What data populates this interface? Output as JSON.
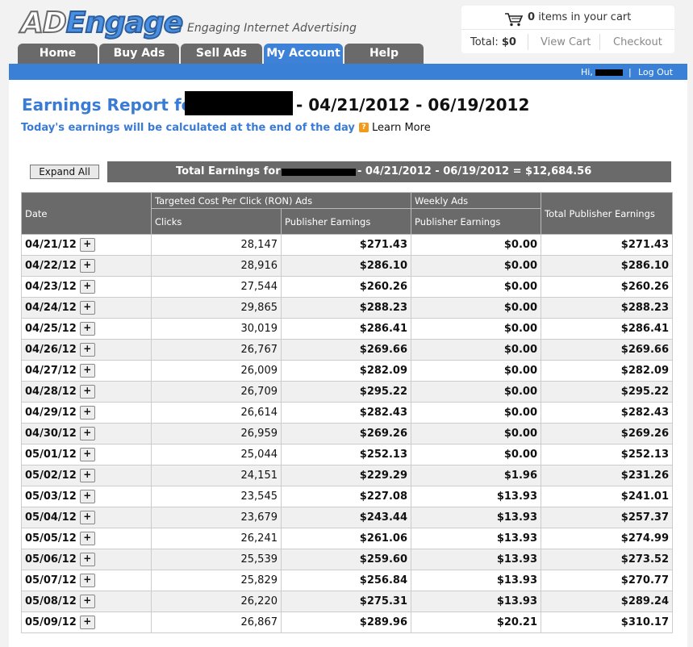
{
  "logo": {
    "ad": "AD",
    "engage": "Engage",
    "tagline": "Engaging Internet Advertising"
  },
  "cart": {
    "count": "0",
    "items_text": "items in your cart",
    "total_label": "Total:",
    "total_value": "$0",
    "view_cart": "View Cart",
    "checkout": "Checkout"
  },
  "nav": {
    "tabs": [
      {
        "label": "Home"
      },
      {
        "label": "Buy Ads"
      },
      {
        "label": "Sell Ads"
      },
      {
        "label": "My Account"
      },
      {
        "label": "Help"
      }
    ]
  },
  "userbar": {
    "hi": "Hi,",
    "separator": "|",
    "logout": "Log Out"
  },
  "report": {
    "title": "Earnings Report for",
    "range": "- 04/21/2012 - 06/19/2012",
    "subtitle": "Today's earnings will be calculated at the end of the day",
    "learn_more": "Learn More",
    "expand_all": "Expand All",
    "total_label": "Total Earnings for",
    "total_range": "- 04/21/2012 - 06/19/2012 = $12,684.56"
  },
  "table": {
    "headers": {
      "date": "Date",
      "cpc_group": "Targeted Cost Per Click (RON) Ads",
      "clicks": "Clicks",
      "publisher_earnings": "Publisher Earnings",
      "weekly_group": "Weekly Ads",
      "weekly_publisher": "Publisher Earnings",
      "total": "Total Publisher Earnings"
    },
    "rows": [
      {
        "date": "04/21/12",
        "clicks": "28,147",
        "cpc": "$271.43",
        "weekly": "$0.00",
        "total": "$271.43"
      },
      {
        "date": "04/22/12",
        "clicks": "28,916",
        "cpc": "$286.10",
        "weekly": "$0.00",
        "total": "$286.10"
      },
      {
        "date": "04/23/12",
        "clicks": "27,544",
        "cpc": "$260.26",
        "weekly": "$0.00",
        "total": "$260.26"
      },
      {
        "date": "04/24/12",
        "clicks": "29,865",
        "cpc": "$288.23",
        "weekly": "$0.00",
        "total": "$288.23"
      },
      {
        "date": "04/25/12",
        "clicks": "30,019",
        "cpc": "$286.41",
        "weekly": "$0.00",
        "total": "$286.41"
      },
      {
        "date": "04/26/12",
        "clicks": "26,767",
        "cpc": "$269.66",
        "weekly": "$0.00",
        "total": "$269.66"
      },
      {
        "date": "04/27/12",
        "clicks": "26,009",
        "cpc": "$282.09",
        "weekly": "$0.00",
        "total": "$282.09"
      },
      {
        "date": "04/28/12",
        "clicks": "26,709",
        "cpc": "$295.22",
        "weekly": "$0.00",
        "total": "$295.22"
      },
      {
        "date": "04/29/12",
        "clicks": "26,614",
        "cpc": "$282.43",
        "weekly": "$0.00",
        "total": "$282.43"
      },
      {
        "date": "04/30/12",
        "clicks": "26,959",
        "cpc": "$269.26",
        "weekly": "$0.00",
        "total": "$269.26"
      },
      {
        "date": "05/01/12",
        "clicks": "25,044",
        "cpc": "$252.13",
        "weekly": "$0.00",
        "total": "$252.13"
      },
      {
        "date": "05/02/12",
        "clicks": "24,151",
        "cpc": "$229.29",
        "weekly": "$1.96",
        "total": "$231.26"
      },
      {
        "date": "05/03/12",
        "clicks": "23,545",
        "cpc": "$227.08",
        "weekly": "$13.93",
        "total": "$241.01"
      },
      {
        "date": "05/04/12",
        "clicks": "23,679",
        "cpc": "$243.44",
        "weekly": "$13.93",
        "total": "$257.37"
      },
      {
        "date": "05/05/12",
        "clicks": "26,241",
        "cpc": "$261.06",
        "weekly": "$13.93",
        "total": "$274.99"
      },
      {
        "date": "05/06/12",
        "clicks": "25,539",
        "cpc": "$259.60",
        "weekly": "$13.93",
        "total": "$273.52"
      },
      {
        "date": "05/07/12",
        "clicks": "25,829",
        "cpc": "$256.84",
        "weekly": "$13.93",
        "total": "$270.77"
      },
      {
        "date": "05/08/12",
        "clicks": "26,220",
        "cpc": "$275.31",
        "weekly": "$13.93",
        "total": "$289.24"
      },
      {
        "date": "05/09/12",
        "clicks": "26,867",
        "cpc": "$289.96",
        "weekly": "$20.21",
        "total": "$310.17"
      }
    ],
    "expand_symbol": "+"
  },
  "colors": {
    "accent": "#3a80d6",
    "tab_gray": "#6a6a6a",
    "title_blue": "#3a7bd5",
    "help_orange": "#f29a1a"
  }
}
